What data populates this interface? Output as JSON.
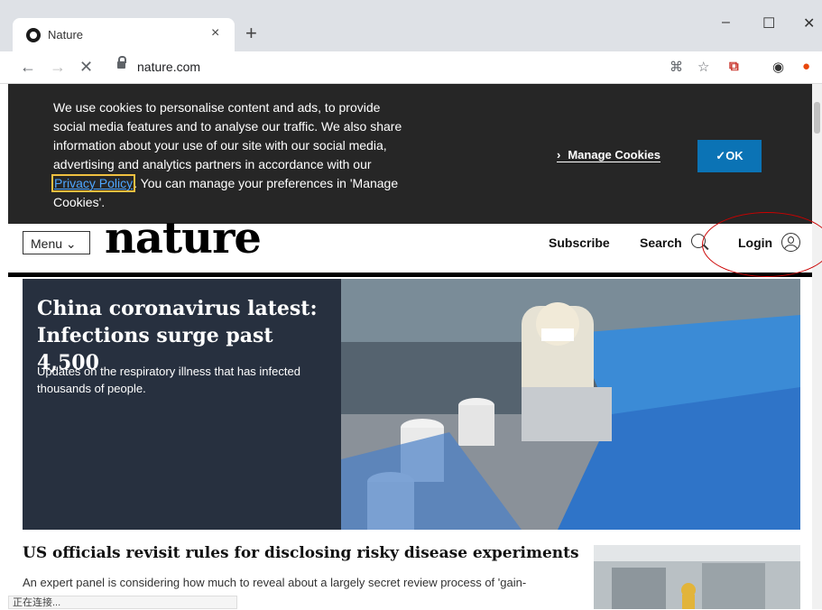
{
  "browser": {
    "tab_title": "Nature",
    "tab_close": "×",
    "new_tab": "+",
    "window_controls": {
      "minimize": "–",
      "maximize": "☐",
      "close": "✕"
    },
    "nav": {
      "back": "←",
      "forward": "→",
      "stop": "✕"
    },
    "url": "nature.com",
    "toolbar_icons": [
      "translate-icon",
      "star-icon",
      "pdf-icon",
      "profile-icon",
      "extension-icon"
    ],
    "status_text": "正在连接..."
  },
  "cookie_banner": {
    "text_before": "We use cookies to personalise content and ads, to provide social media features and to analyse our traffic. We also share information about your use of our site with our social media, advertising and analytics partners in accordance with our ",
    "privacy_link": "Privacy Policy",
    "text_after": ". You can manage your preferences in 'Manage Cookies'.",
    "manage_label": "Manage Cookies",
    "ok_label": "✓OK"
  },
  "header": {
    "menu_label": "Menu",
    "logo": "nature",
    "subscribe": "Subscribe",
    "search": "Search",
    "login": "Login"
  },
  "hero": {
    "title": "China coronavirus latest: Infections surge past 4,500",
    "description": "Updates on the respiratory illness that has infected thousands of people."
  },
  "story2": {
    "title": "US officials revisit rules for disclosing risky disease experiments",
    "description": "An expert panel is considering how much to reveal about a largely secret review process of 'gain-"
  },
  "colors": {
    "accent": "#0b73b5",
    "banner_bg": "#262626",
    "hero_bg": "#27303f",
    "annotation_red": "#cc0000"
  }
}
